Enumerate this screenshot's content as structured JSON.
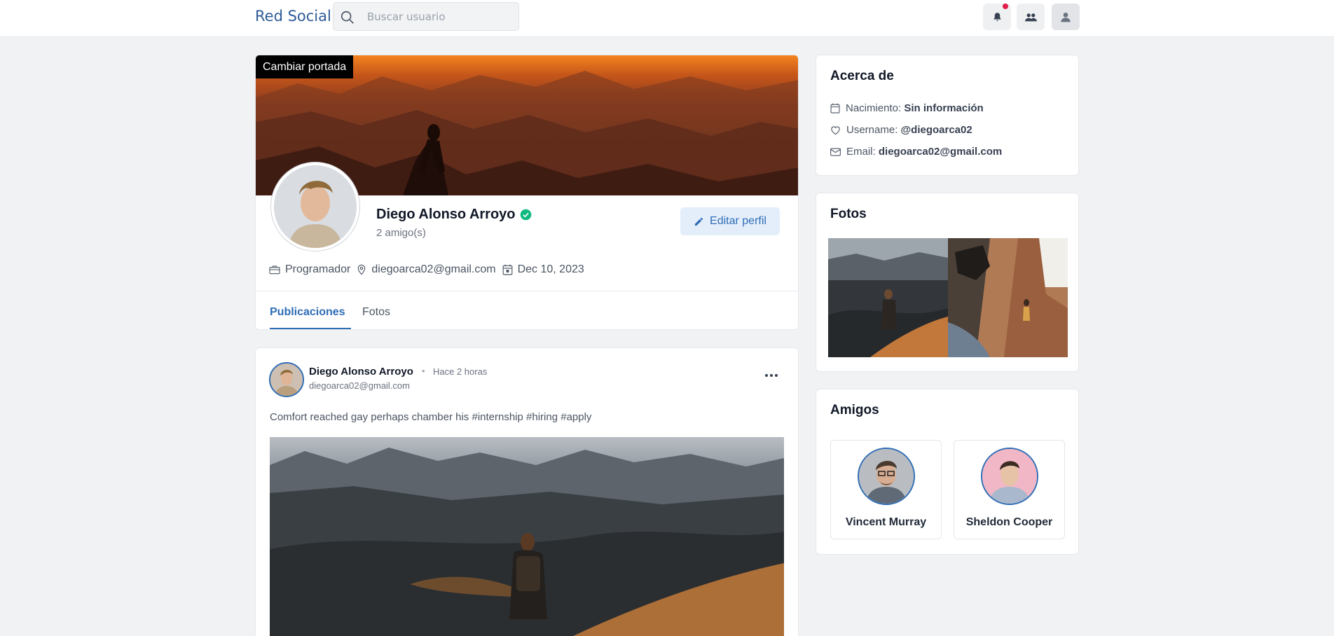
{
  "nav": {
    "brand": "Red Social",
    "search_placeholder": "Buscar usuario",
    "icons": [
      "bell-icon",
      "friends-icon",
      "user-icon"
    ],
    "has_notification": true
  },
  "profile": {
    "cover_button": "Cambiar portada",
    "name": "Diego Alonso Arroyo",
    "verified": true,
    "friends_count": "2 amigo(s)",
    "edit_button": "Editar perfil",
    "meta": {
      "occupation": "Programador",
      "email": "diegoarca02@gmail.com",
      "joined": "Dec 10, 2023"
    },
    "tabs": [
      {
        "label": "Publicaciones",
        "active": true
      },
      {
        "label": "Fotos",
        "active": false
      }
    ]
  },
  "post": {
    "author": "Diego Alonso Arroyo",
    "time": "Hace 2 horas",
    "email": "diegoarca02@gmail.com",
    "text": "Comfort reached gay perhaps chamber his #internship #hiring #apply"
  },
  "about": {
    "title": "Acerca de",
    "birth_label": "Nacimiento:",
    "birth_value": "Sin información",
    "username_label": "Username:",
    "username_value": "@diegoarca02",
    "email_label": "Email:",
    "email_value": "diegoarca02@gmail.com"
  },
  "photos": {
    "title": "Fotos"
  },
  "friends": {
    "title": "Amigos",
    "items": [
      {
        "name": "Vincent Murray"
      },
      {
        "name": "Sheldon Cooper"
      }
    ]
  },
  "colors": {
    "accent": "#2f6db5",
    "brand": "#2f5b98",
    "verified": "#10b981",
    "notification": "#e11d48"
  }
}
